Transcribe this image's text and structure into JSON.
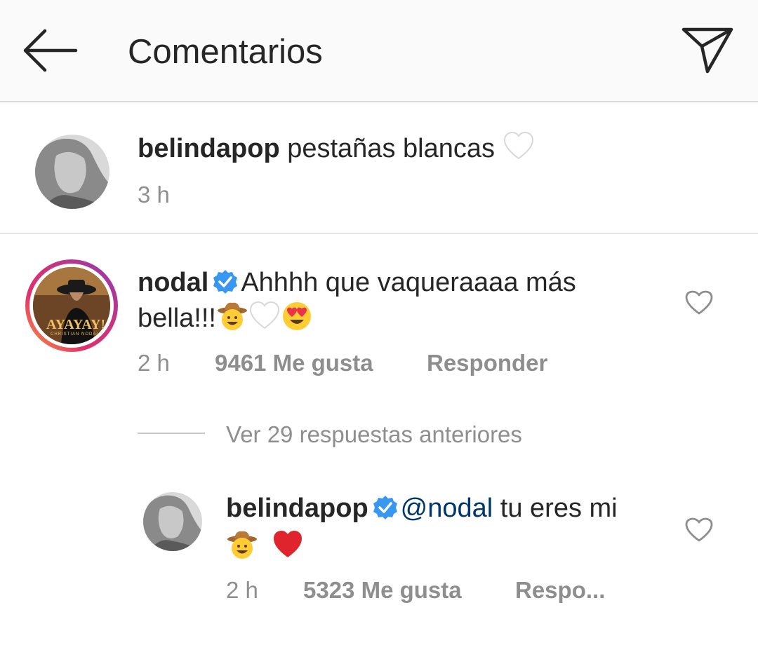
{
  "header": {
    "title": "Comentarios",
    "back_icon": "back-arrow-icon",
    "share_icon": "paper-plane-icon"
  },
  "caption": {
    "username": "belindapop",
    "text": "pestañas blancas",
    "emoji": "white-heart",
    "time": "3 h"
  },
  "comment": {
    "username": "nodal",
    "verified": true,
    "text_line1": "Ahhhh que vaqueraaaa más",
    "text_line2": "bella!!!",
    "emojis": [
      "cowboy-face",
      "white-heart",
      "heart-eyes"
    ],
    "avatar_text": "AYAYAY!",
    "avatar_subtext": "CHRISTIAN NODAL",
    "time": "2 h",
    "likes": "9461 Me gusta",
    "reply_label": "Responder"
  },
  "view_replies": "Ver 29 respuestas anteriores",
  "reply": {
    "username": "belindapop",
    "verified": true,
    "mention": "@nodal",
    "text": "tu eres mi",
    "emojis": [
      "cowboy-face",
      "red-heart"
    ],
    "time": "2 h",
    "likes": "5323 Me gusta",
    "reply_label": "Respo..."
  },
  "colors": {
    "text": "#262626",
    "meta": "#8e8e8e",
    "verified": "#3897f0",
    "mention": "#00376b",
    "red_heart": "#e0242e"
  }
}
